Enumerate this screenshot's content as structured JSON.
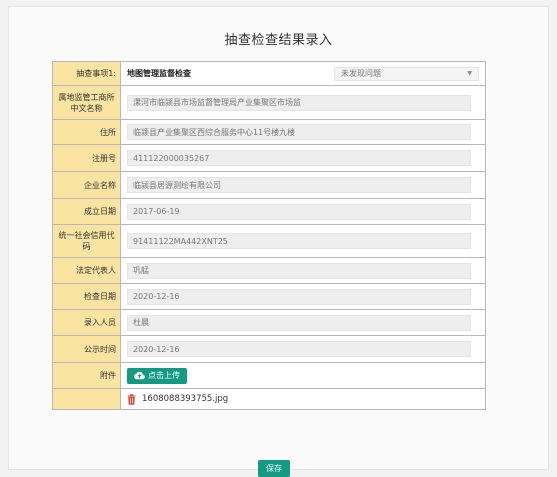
{
  "title": "抽查检查结果录入",
  "form": {
    "check_item": {
      "label": "抽查事项1:",
      "value": "地图管理监督检查",
      "select_value": "未发现问题"
    },
    "fields": [
      {
        "key": "region",
        "label": "属地监管工商所中文名称",
        "value": "漯河市临颍县市场监督管理局产业集聚区市场监"
      },
      {
        "key": "address",
        "label": "住所",
        "value": "临颍县产业集聚区西综合服务中心11号楼九楼"
      },
      {
        "key": "reg_no",
        "label": "注册号",
        "value": "411122000035267"
      },
      {
        "key": "company",
        "label": "企业名称",
        "value": "临颍县居源测绘有限公司"
      },
      {
        "key": "founded",
        "label": "成立日期",
        "value": "2017-06-19"
      },
      {
        "key": "credit_code",
        "label": "统一社会信用代码",
        "value": "91411122MA442XNT25"
      },
      {
        "key": "legal_rep",
        "label": "法定代表人",
        "value": "巩艋"
      },
      {
        "key": "check_date",
        "label": "检查日期",
        "value": "2020-12-16"
      },
      {
        "key": "entry_person",
        "label": "录入人员",
        "value": "杜晨"
      },
      {
        "key": "publish_time",
        "label": "公示时间",
        "value": "2020-12-16"
      }
    ],
    "attachment": {
      "label": "附件",
      "upload_label": "点击上传",
      "file_name": "1608088393755.jpg"
    }
  },
  "save_label": "保存",
  "colors": {
    "label_bg": "#fbe3a1",
    "accent": "#129a83"
  },
  "icons": {
    "upload": "cloud-upload-icon",
    "delete": "trash-icon"
  }
}
